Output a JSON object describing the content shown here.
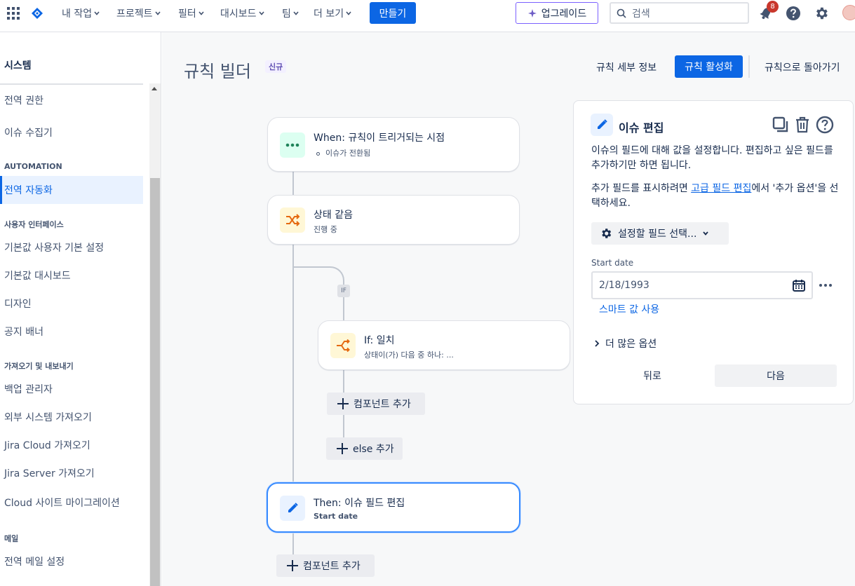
{
  "topnav": {
    "items": [
      "내 작업",
      "프로젝트",
      "필터",
      "대시보드",
      "팀",
      "더 보기"
    ],
    "create": "만들기",
    "upgrade": "업그레이드",
    "search_placeholder": "검색",
    "notification_count": "8"
  },
  "sidebar": {
    "title": "시스템",
    "items": {
      "global_permissions": "전역 권한",
      "issue_collectors": "이슈 수집기",
      "automation_section": "AUTOMATION",
      "global_automation": "전역 자동화",
      "ui_section": "사용자 인터페이스",
      "default_user_prefs": "기본값 사용자 기본 설정",
      "default_dashboard": "기본값 대시보드",
      "design": "디자인",
      "announcement_banner": "공지 배너",
      "import_export_section": "가져오기 및 내보내기",
      "backup_manager": "백업 관리자",
      "external_import": "외부 시스템 가져오기",
      "jira_cloud_import": "Jira Cloud 가져오기",
      "jira_server_import": "Jira Server 가져오기",
      "cloud_migration": "Cloud 사이트 마이그레이션",
      "mail_section": "메일",
      "global_mail_settings": "전역 메일 설정"
    }
  },
  "header": {
    "title": "규칙 빌더",
    "badge": "신규",
    "rule_details": "규칙 세부 정보",
    "enable_rule": "규칙 활성화",
    "back_to_rules": "규칙으로 돌아가기"
  },
  "flow": {
    "trigger": {
      "title": "When: 규칙이 트리거되는 시점",
      "sub": "이슈가 전환됨"
    },
    "condition": {
      "title": "상태 같음",
      "sub": "진행 중"
    },
    "if_tag": "IF",
    "if_block": {
      "title": "If: 일치",
      "sub": "상태이(가) 다음 중 하나: ..."
    },
    "add_component": "컴포넌트 추가",
    "add_else": "else 추가",
    "action": {
      "title": "Then: 이슈 필드 편집",
      "sub": "Start date"
    }
  },
  "panel": {
    "title": "이슈 편집",
    "desc": "이슈의 필드에 대해 값을 설정합니다. 편집하고 싶은 필드를 추가하기만 하면 됩니다.",
    "desc2_before": "추가 필드를 표시하려면 ",
    "desc2_link": "고급 필드 편집",
    "desc2_after": "에서 '추가 옵션'을 선택하세요.",
    "select_field": "설정할 필드 선택...",
    "field_label": "Start date",
    "field_value": "2/18/1993",
    "smart_value": "스마트 값 사용",
    "more_options": "더 많은 옵션",
    "back": "뒤로",
    "next": "다음"
  },
  "colors": {
    "primary": "#0c66e4",
    "trigger_bg": "#dcfff1",
    "condition_bg": "#fff7d6",
    "action_bg": "#e9f2ff",
    "upgrade_border": "#7b61ff"
  }
}
